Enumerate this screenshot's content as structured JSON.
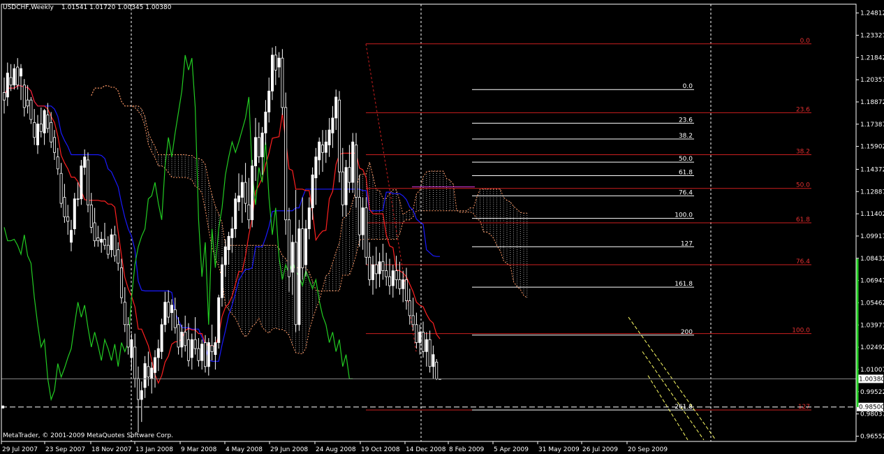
{
  "header": {
    "symbol": "USDCHF,Weekly",
    "ohlc": "1.01541 1.01720 1.00345 1.00380"
  },
  "footer": {
    "copyright": "MetaTrader, © 2001-2009 MetaQuotes Software Corp."
  },
  "colors": {
    "background": "#000000",
    "candle": "#ffffff",
    "bull_body": "#ffffff",
    "bear_body": "#000000",
    "tenkan": "#ff2020",
    "kijun": "#1a1aff",
    "chikou": "#22cc22",
    "fib_red": "#cc1f1f",
    "fib_white": "#ffffff",
    "channel": "#ffff66",
    "kumo": "#ffffff",
    "kumo_edge": "#ff9966",
    "grid": "#ffffff",
    "magenta_line": "#cc33cc"
  },
  "chart_data": {
    "type": "candlestick",
    "timeframe": "Weekly",
    "symbol": "USDCHF",
    "last_ohlc": {
      "open": 1.01541,
      "high": 1.0172,
      "low": 1.00345,
      "close": 1.0038
    },
    "current_price_label": "1.00380",
    "alert_price_label": "0.98500",
    "price_axis": {
      "min": 0.962,
      "max": 1.254,
      "labels": [
        "1.24812",
        "1.23327",
        "1.21842",
        "1.20357",
        "1.18872",
        "1.17387",
        "1.15902",
        "1.14372",
        "1.12887",
        "1.11402",
        "1.09917",
        "1.08432",
        "1.06947",
        "1.05462",
        "1.03977",
        "1.02492",
        "1.01007",
        "0.99522",
        "0.98037",
        "0.96552"
      ]
    },
    "time_axis": [
      "29 Jul 2007",
      "23 Sep 2007",
      "18 Nov 2007",
      "13 Jan 2008",
      "9 Mar 2008",
      "4 May 2008",
      "29 Jun 2008",
      "24 Aug 2008",
      "19 Oct 2008",
      "14 Dec 2008",
      "8 Feb 2009",
      "5 Apr 2009",
      "31 May 2009",
      "26 Jul 2009",
      "20 Sep 2009"
    ],
    "weeks": 141,
    "fib_red": {
      "levels": [
        {
          "label": "0.0",
          "price": 1.2275
        },
        {
          "label": "23.6",
          "price": 1.1815
        },
        {
          "label": "38.2",
          "price": 1.1535
        },
        {
          "label": "50.0",
          "price": 1.131
        },
        {
          "label": "61.8",
          "price": 1.108
        },
        {
          "label": "76.4",
          "price": 1.08
        },
        {
          "label": "100.0",
          "price": 1.034
        },
        {
          "label": "127",
          "price": 0.983
        }
      ]
    },
    "fib_white": {
      "levels": [
        {
          "label": "0.0",
          "price": 1.197
        },
        {
          "label": "23.6",
          "price": 1.1745
        },
        {
          "label": "38.2",
          "price": 1.164
        },
        {
          "label": "50.0",
          "price": 1.1485
        },
        {
          "label": "61.8",
          "price": 1.1395
        },
        {
          "label": "76.4",
          "price": 1.126
        },
        {
          "label": "100.0",
          "price": 1.111
        },
        {
          "label": "127",
          "price": 1.092
        },
        {
          "label": "161.8",
          "price": 1.065
        },
        {
          "label": "200",
          "price": 1.033
        },
        {
          "label": "261.8",
          "price": 0.983
        }
      ]
    },
    "candles": [
      [
        1.195,
        1.205,
        1.181,
        1.19
      ],
      [
        1.192,
        1.215,
        1.186,
        1.208
      ],
      [
        1.205,
        1.214,
        1.196,
        1.2
      ],
      [
        1.2,
        1.214,
        1.197,
        1.211
      ],
      [
        1.212,
        1.218,
        1.197,
        1.2
      ],
      [
        1.206,
        1.214,
        1.19,
        1.211
      ],
      [
        1.2,
        1.204,
        1.179,
        1.185
      ],
      [
        1.19,
        1.2,
        1.181,
        1.186
      ],
      [
        1.19,
        1.192,
        1.174,
        1.177
      ],
      [
        1.175,
        1.184,
        1.16,
        1.165
      ],
      [
        1.16,
        1.18,
        1.154,
        1.174
      ],
      [
        1.174,
        1.185,
        1.165,
        1.169
      ],
      [
        1.168,
        1.184,
        1.16,
        1.183
      ],
      [
        1.18,
        1.188,
        1.168,
        1.171
      ],
      [
        1.175,
        1.182,
        1.158,
        1.162
      ],
      [
        1.165,
        1.17,
        1.15,
        1.155
      ],
      [
        1.152,
        1.158,
        1.14,
        1.144
      ],
      [
        1.141,
        1.148,
        1.118,
        1.121
      ],
      [
        1.125,
        1.134,
        1.108,
        1.112
      ],
      [
        1.112,
        1.12,
        1.1,
        1.109
      ],
      [
        1.095,
        1.11,
        1.089,
        1.103
      ],
      [
        1.104,
        1.128,
        1.1,
        1.124
      ],
      [
        1.124,
        1.135,
        1.119,
        1.124
      ],
      [
        1.124,
        1.15,
        1.12,
        1.146
      ],
      [
        1.145,
        1.157,
        1.14,
        1.152
      ],
      [
        1.15,
        1.155,
        1.115,
        1.12
      ],
      [
        1.12,
        1.128,
        1.101,
        1.105
      ],
      [
        1.108,
        1.118,
        1.092,
        1.096
      ],
      [
        1.098,
        1.106,
        1.092,
        1.096
      ],
      [
        1.095,
        1.102,
        1.088,
        1.097
      ],
      [
        1.097,
        1.108,
        1.09,
        1.093
      ],
      [
        1.093,
        1.099,
        1.084,
        1.087
      ],
      [
        1.09,
        1.104,
        1.085,
        1.1
      ],
      [
        1.1,
        1.106,
        1.082,
        1.086
      ],
      [
        1.09,
        1.095,
        1.076,
        1.081
      ],
      [
        1.078,
        1.084,
        1.054,
        1.058
      ],
      [
        1.055,
        1.065,
        1.035,
        1.04
      ],
      [
        1.04,
        1.045,
        1.02,
        1.025
      ],
      [
        1.018,
        1.034,
        1.01,
        1.03
      ],
      [
        1.025,
        1.034,
        0.998,
        1.004
      ],
      [
        1.004,
        1.012,
        0.968,
        0.99
      ],
      [
        0.99,
        1.002,
        0.975,
        0.996
      ],
      [
        0.998,
        1.019,
        0.991,
        1.014
      ],
      [
        1.012,
        1.022,
        0.999,
        1.005
      ],
      [
        1.004,
        1.015,
        0.994,
        1.011
      ],
      [
        1.008,
        1.023,
        0.998,
        1.018
      ],
      [
        1.018,
        1.03,
        1.009,
        1.024
      ],
      [
        1.022,
        1.044,
        1.017,
        1.04
      ],
      [
        1.04,
        1.062,
        1.035,
        1.055
      ],
      [
        1.055,
        1.063,
        1.041,
        1.045
      ],
      [
        1.048,
        1.057,
        1.036,
        1.053
      ],
      [
        1.05,
        1.058,
        1.034,
        1.038
      ],
      [
        1.04,
        1.045,
        1.02,
        1.025
      ],
      [
        1.025,
        1.04,
        1.018,
        1.035
      ],
      [
        1.035,
        1.046,
        1.022,
        1.026
      ],
      [
        1.03,
        1.041,
        1.012,
        1.016
      ],
      [
        1.018,
        1.034,
        1.01,
        1.03
      ],
      [
        1.03,
        1.045,
        1.02,
        1.024
      ],
      [
        1.024,
        1.031,
        1.012,
        1.016
      ],
      [
        1.016,
        1.03,
        1.01,
        1.027
      ],
      [
        1.028,
        1.033,
        1.008,
        1.012
      ],
      [
        1.012,
        1.031,
        1.006,
        1.028
      ],
      [
        1.026,
        1.04,
        1.016,
        1.022
      ],
      [
        1.02,
        1.032,
        1.01,
        1.028
      ],
      [
        1.028,
        1.06,
        1.024,
        1.058
      ],
      [
        1.058,
        1.085,
        1.052,
        1.08
      ],
      [
        1.08,
        1.097,
        1.072,
        1.092
      ],
      [
        1.09,
        1.102,
        1.08,
        1.099
      ],
      [
        1.098,
        1.112,
        1.088,
        1.104
      ],
      [
        1.104,
        1.128,
        1.098,
        1.124
      ],
      [
        1.122,
        1.141,
        1.116,
        1.126
      ],
      [
        1.125,
        1.14,
        1.108,
        1.135
      ],
      [
        1.135,
        1.148,
        1.115,
        1.121
      ],
      [
        1.12,
        1.138,
        1.104,
        1.11
      ],
      [
        1.11,
        1.15,
        1.105,
        1.146
      ],
      [
        1.146,
        1.178,
        1.136,
        1.165
      ],
      [
        1.165,
        1.175,
        1.148,
        1.152
      ],
      [
        1.152,
        1.172,
        1.14,
        1.168
      ],
      [
        1.168,
        1.19,
        1.16,
        1.182
      ],
      [
        1.182,
        1.205,
        1.175,
        1.196
      ],
      [
        1.196,
        1.225,
        1.19,
        1.22
      ],
      [
        1.22,
        1.226,
        1.2,
        1.21
      ],
      [
        1.212,
        1.222,
        1.205,
        1.218
      ],
      [
        1.218,
        1.224,
        1.18,
        1.185
      ],
      [
        1.185,
        1.195,
        1.1,
        1.11
      ],
      [
        1.11,
        1.118,
        1.062,
        1.072
      ],
      [
        1.075,
        1.1,
        1.06,
        1.095
      ],
      [
        1.095,
        1.13,
        1.035,
        1.04
      ],
      [
        1.04,
        1.11,
        1.036,
        1.104
      ],
      [
        1.104,
        1.125,
        1.07,
        1.078
      ],
      [
        1.08,
        1.11,
        1.072,
        1.104
      ],
      [
        1.104,
        1.125,
        1.097,
        1.118
      ],
      [
        1.118,
        1.145,
        1.11,
        1.14
      ],
      [
        1.138,
        1.158,
        1.12,
        1.152
      ],
      [
        1.15,
        1.165,
        1.14,
        1.162
      ],
      [
        1.16,
        1.17,
        1.142,
        1.155
      ],
      [
        1.155,
        1.17,
        1.148,
        1.162
      ],
      [
        1.16,
        1.178,
        1.152,
        1.17
      ],
      [
        1.168,
        1.186,
        1.158,
        1.178
      ],
      [
        1.178,
        1.197,
        1.17,
        1.192
      ],
      [
        1.19,
        1.196,
        1.135,
        1.142
      ],
      [
        1.142,
        1.158,
        1.112,
        1.12
      ],
      [
        1.12,
        1.15,
        1.112,
        1.145
      ],
      [
        1.145,
        1.16,
        1.128,
        1.135
      ],
      [
        1.135,
        1.168,
        1.128,
        1.162
      ],
      [
        1.16,
        1.168,
        1.118,
        1.125
      ],
      [
        1.125,
        1.14,
        1.092,
        1.1
      ],
      [
        1.1,
        1.125,
        1.09,
        1.118
      ],
      [
        1.118,
        1.125,
        1.08,
        1.085
      ],
      [
        1.085,
        1.095,
        1.066,
        1.07
      ],
      [
        1.07,
        1.086,
        1.06,
        1.08
      ],
      [
        1.08,
        1.092,
        1.064,
        1.074
      ],
      [
        1.074,
        1.088,
        1.065,
        1.082
      ],
      [
        1.082,
        1.094,
        1.07,
        1.076
      ],
      [
        1.076,
        1.088,
        1.066,
        1.072
      ],
      [
        1.072,
        1.084,
        1.06,
        1.066
      ],
      [
        1.066,
        1.08,
        1.058,
        1.076
      ],
      [
        1.076,
        1.086,
        1.064,
        1.07
      ],
      [
        1.07,
        1.082,
        1.06,
        1.064
      ],
      [
        1.064,
        1.076,
        1.055,
        1.07
      ],
      [
        1.07,
        1.078,
        1.05,
        1.056
      ],
      [
        1.056,
        1.064,
        1.04,
        1.046
      ],
      [
        1.046,
        1.058,
        1.036,
        1.04
      ],
      [
        1.04,
        1.048,
        1.024,
        1.028
      ],
      [
        1.028,
        1.04,
        1.02,
        1.035
      ],
      [
        1.035,
        1.042,
        1.018,
        1.022
      ],
      [
        1.022,
        1.035,
        1.012,
        1.03
      ],
      [
        1.03,
        1.036,
        1.008,
        1.012
      ],
      [
        1.012,
        1.026,
        1.004,
        1.02
      ],
      [
        1.015,
        1.017,
        1.003,
        1.0038
      ],
      [
        1.0038,
        1.0039,
        1.0038,
        1.0038
      ]
    ]
  }
}
